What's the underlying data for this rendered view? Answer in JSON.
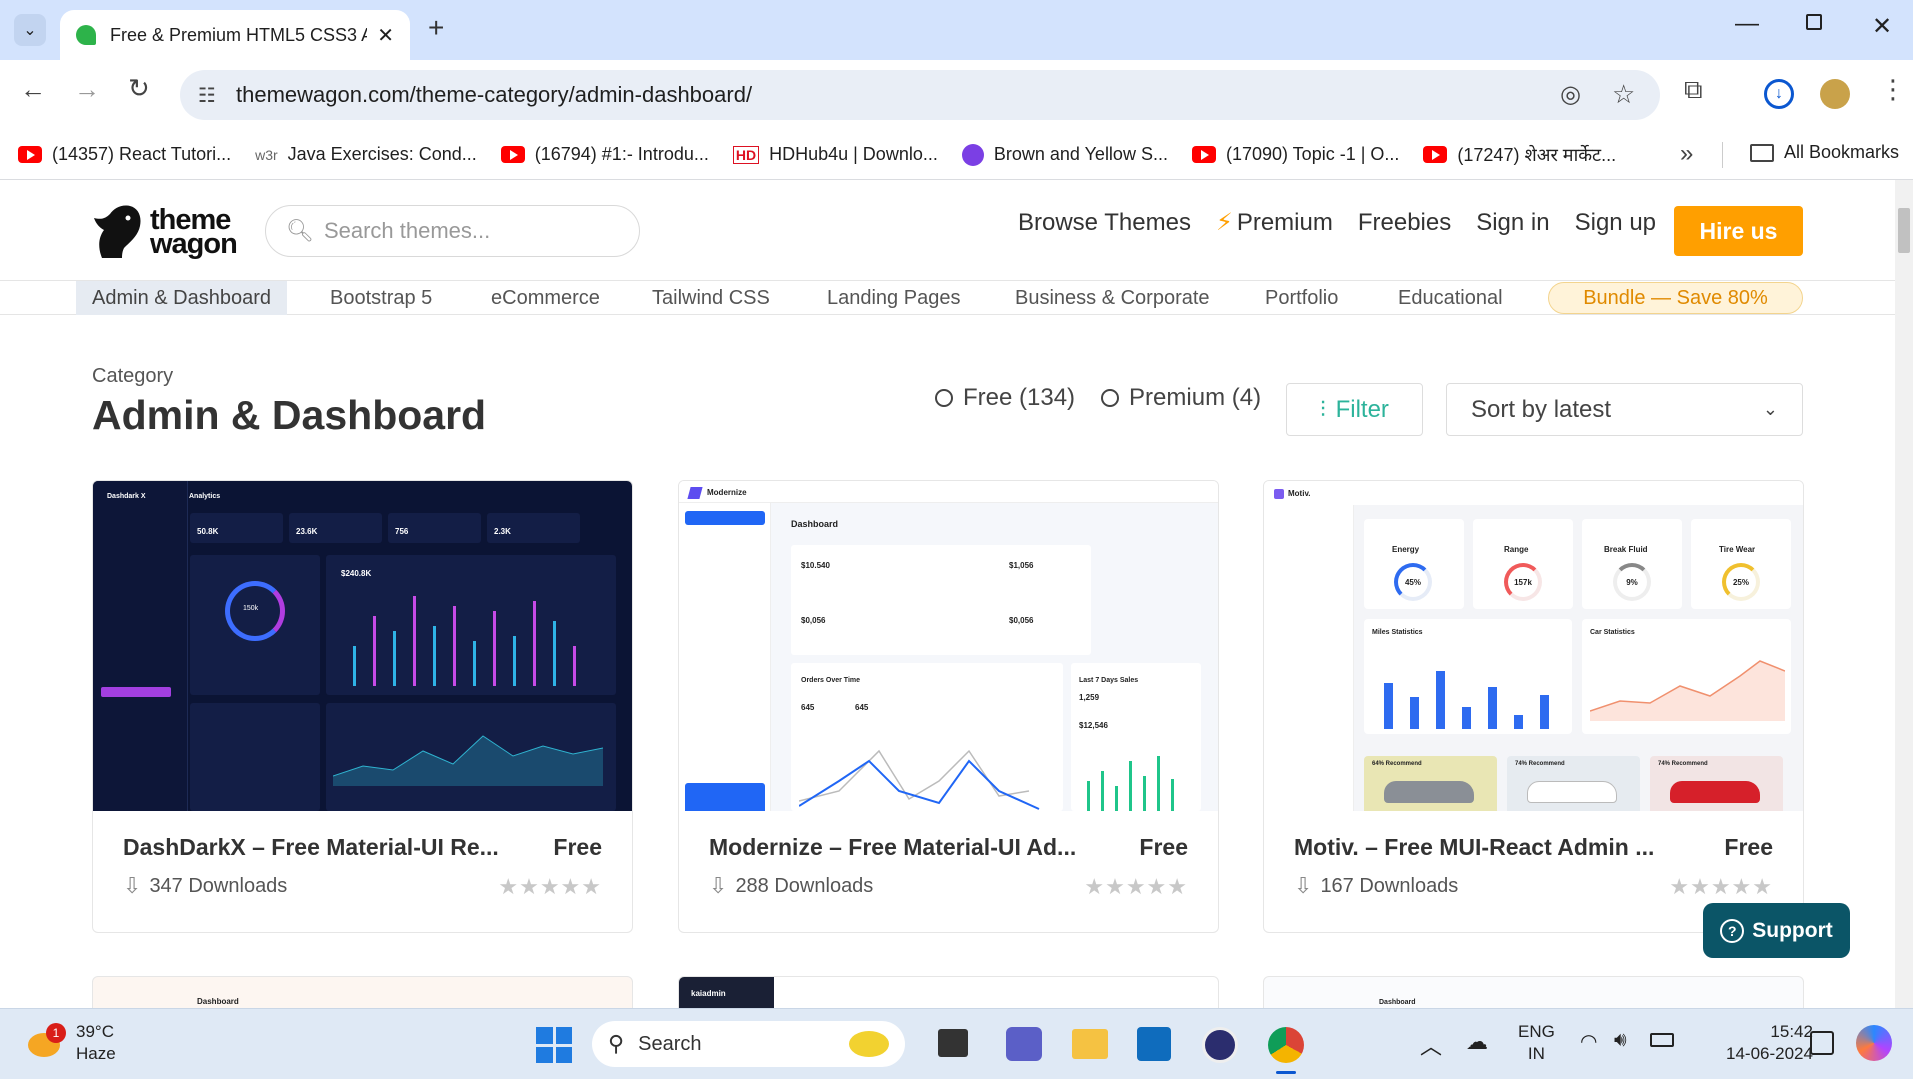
{
  "browser": {
    "tab_title": "Free & Premium HTML5 CSS3 A",
    "url": "themewagon.com/theme-category/admin-dashboard/",
    "bookmarks": [
      {
        "label": "(14357) React Tutori...",
        "icon": "youtube-icon"
      },
      {
        "label": "Java Exercises: Cond...",
        "icon": "w3r-icon",
        "icon_text": "w3r"
      },
      {
        "label": "(16794) #1:- Introdu...",
        "icon": "youtube-icon"
      },
      {
        "label": "HDHub4u | Downlo...",
        "icon": "hd-icon",
        "icon_text": "HD"
      },
      {
        "label": "Brown and Yellow S...",
        "icon": "canva-icon"
      },
      {
        "label": "(17090) Topic -1 | O...",
        "icon": "youtube-icon"
      },
      {
        "label": "(17247) शेअर मार्केट...",
        "icon": "youtube-icon"
      }
    ],
    "all_bookmarks": "All Bookmarks"
  },
  "site": {
    "logo_line1": "theme",
    "logo_line2": "wagon",
    "search_placeholder": "Search themes...",
    "nav": {
      "browse": "Browse Themes",
      "premium": "Premium",
      "freebies": "Freebies",
      "signin": "Sign in",
      "signup": "Sign up",
      "hire": "Hire us"
    },
    "categories": [
      "Admin & Dashboard",
      "Bootstrap 5",
      "eCommerce",
      "Tailwind CSS",
      "Landing Pages",
      "Business & Corporate",
      "Portfolio",
      "Educational"
    ],
    "bundle": "Bundle — Save 80%",
    "category_label": "Category",
    "category_title": "Admin & Dashboard",
    "filter_free": "Free (134)",
    "filter_premium": "Premium (4)",
    "filter_button": "Filter",
    "sort_selected": "Sort by latest",
    "support": "Support"
  },
  "cards": [
    {
      "title": "DashDarkX – Free Material-UI Re...",
      "price": "Free",
      "downloads": "347 Downloads",
      "rating_stars": 0,
      "thumb": {
        "brand": "Dashdark X",
        "heading": "Analytics",
        "stats": [
          "50.8K",
          "23.6K",
          "756",
          "2.3K"
        ],
        "big": "$240.8K",
        "gauge": "150k"
      }
    },
    {
      "title": "Modernize – Free Material-UI Ad...",
      "price": "Free",
      "downloads": "288 Downloads",
      "rating_stars": 0,
      "thumb": {
        "brand": "Modernize",
        "heading": "Dashboard",
        "stats": [
          "$10.540",
          "$1,056",
          "$0,056",
          "$0,056"
        ],
        "orders_title": "Orders Over Time",
        "sales_title": "Last 7 Days Sales",
        "sales_a": "1,259",
        "sales_b": "$12,546",
        "o1": "645",
        "o2": "645"
      }
    },
    {
      "title": "Motiv. – Free MUI-React Admin ...",
      "price": "Free",
      "downloads": "167 Downloads",
      "rating_stars": 0,
      "thumb": {
        "brand": "Motiv.",
        "gauges": [
          {
            "label": "Energy",
            "value": "45%"
          },
          {
            "label": "Range",
            "value": "157k"
          },
          {
            "label": "Break Fluid",
            "value": "9%"
          },
          {
            "label": "Tire Wear",
            "value": "25%"
          }
        ],
        "chart1": "Miles Statistics",
        "chart2": "Car Statistics",
        "cars": [
          "64% Recommend",
          "74% Recommend",
          "74% Recommend"
        ]
      }
    }
  ],
  "second_row": [
    {
      "label": "Dashboard"
    },
    {
      "label": "kaiadmin"
    },
    {
      "label": "Dashboard"
    }
  ],
  "taskbar": {
    "weather_temp": "39°C",
    "weather_desc": "Haze",
    "weather_badge": "1",
    "search": "Search",
    "lang1": "ENG",
    "lang2": "IN",
    "time": "15:42",
    "date": "14-06-2024"
  }
}
